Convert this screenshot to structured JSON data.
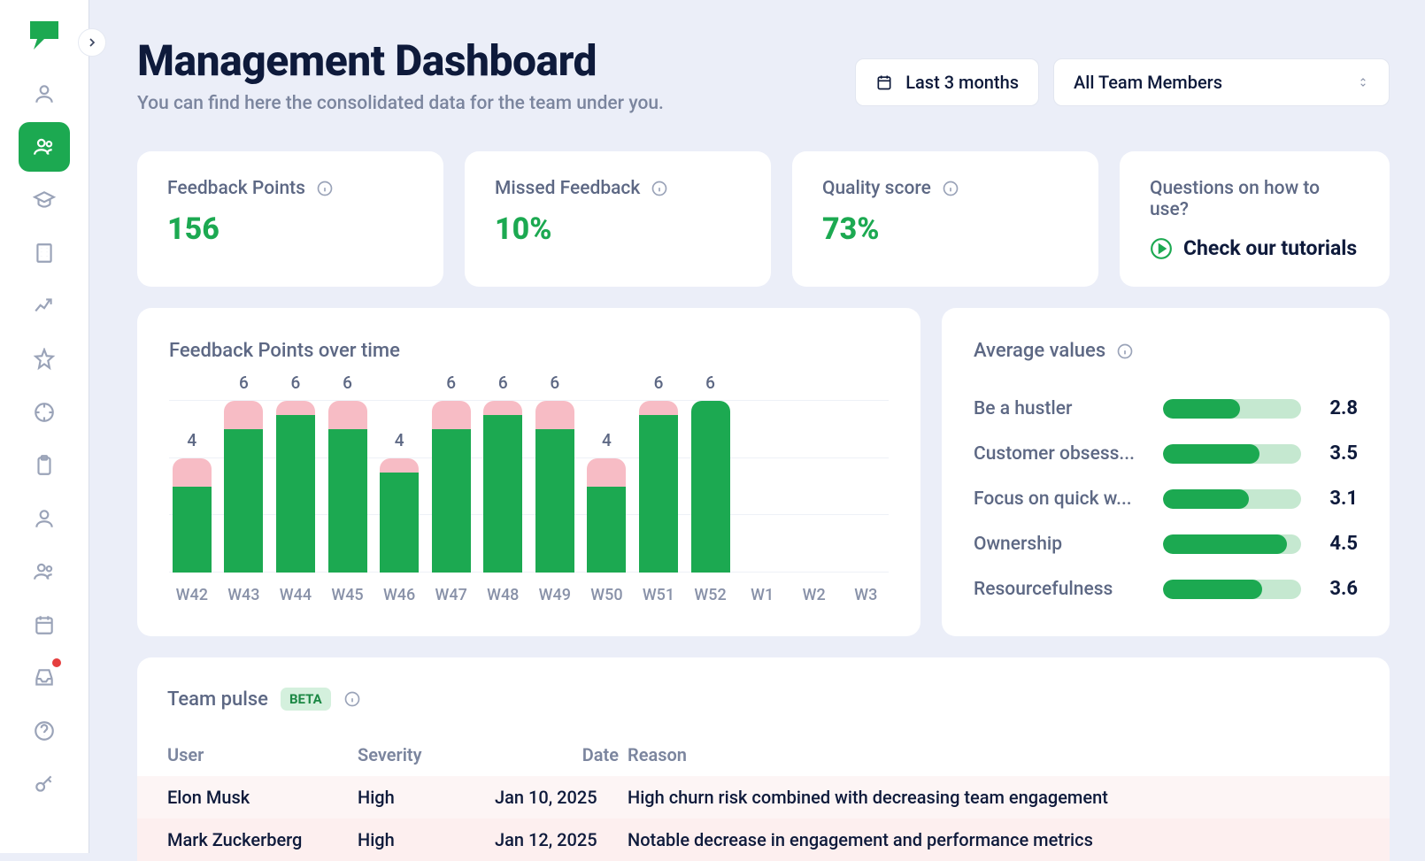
{
  "header": {
    "title": "Management Dashboard",
    "subtitle": "You can find here the consolidated data for the team under you.",
    "date_filter": "Last 3 months",
    "team_filter": "All Team Members"
  },
  "stats": [
    {
      "label": "Feedback Points",
      "value": "156"
    },
    {
      "label": "Missed Feedback",
      "value": "10%"
    },
    {
      "label": "Quality score",
      "value": "73%"
    }
  ],
  "tutorial": {
    "question": "Questions on how to use?",
    "link": "Check our tutorials"
  },
  "chart_title": "Feedback Points over time",
  "chart_data": {
    "type": "bar",
    "title": "Feedback Points over time",
    "categories": [
      "W42",
      "W43",
      "W44",
      "W45",
      "W46",
      "W47",
      "W48",
      "W49",
      "W50",
      "W51",
      "W52",
      "W1",
      "W2",
      "W3"
    ],
    "series": [
      {
        "name": "green",
        "values": [
          3.0,
          5.0,
          5.5,
          5.0,
          3.5,
          5.0,
          5.5,
          5.0,
          3.0,
          5.5,
          6.0,
          null,
          null,
          null
        ]
      },
      {
        "name": "pink",
        "values": [
          1.0,
          1.0,
          0.5,
          1.0,
          0.5,
          1.0,
          0.5,
          1.0,
          1.0,
          0.5,
          0.0,
          null,
          null,
          null
        ]
      }
    ],
    "totals": [
      4,
      6,
      6,
      6,
      4,
      6,
      6,
      6,
      4,
      6,
      6,
      null,
      null,
      null
    ],
    "ylim": [
      0,
      6
    ],
    "y_gridlines": [
      0,
      2,
      4,
      6
    ]
  },
  "averages": {
    "title": "Average values",
    "items": [
      {
        "name": "Be a hustler",
        "score": "2.8",
        "pct": 56
      },
      {
        "name": "Customer obsess...",
        "score": "3.5",
        "pct": 70
      },
      {
        "name": "Focus on quick w...",
        "score": "3.1",
        "pct": 62
      },
      {
        "name": "Ownership",
        "score": "4.5",
        "pct": 90
      },
      {
        "name": "Resourcefulness",
        "score": "3.6",
        "pct": 72
      }
    ],
    "max_score": 5
  },
  "pulse": {
    "title": "Team pulse",
    "badge": "BETA",
    "columns": {
      "user": "User",
      "severity": "Severity",
      "date": "Date",
      "reason": "Reason"
    },
    "rows": [
      {
        "user": "Elon Musk",
        "severity": "High",
        "date": "Jan 10, 2025",
        "reason": "High churn risk combined with decreasing team engagement"
      },
      {
        "user": "Mark Zuckerberg",
        "severity": "High",
        "date": "Jan 12, 2025",
        "reason": "Notable decrease in engagement and performance metrics"
      }
    ]
  }
}
